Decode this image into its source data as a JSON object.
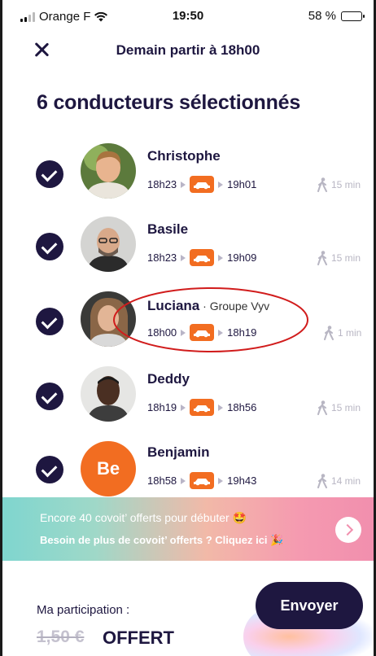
{
  "status_bar": {
    "carrier": "Orange F",
    "time": "19:50",
    "battery": "58 %",
    "battery_level": 0.58
  },
  "header": {
    "title": "Demain partir à 18h00"
  },
  "page_title": "6 conducteurs sélectionnés",
  "drivers": [
    {
      "name": "Christophe",
      "company": "",
      "depart": "18h23",
      "arrive": "19h01",
      "walk": "15 min",
      "avatar_bg": "#6f8a4a"
    },
    {
      "name": "Basile",
      "company": "",
      "depart": "18h23",
      "arrive": "19h09",
      "walk": "15 min",
      "avatar_bg": "#cfcfcf"
    },
    {
      "name": "Luciana",
      "company": " · Groupe Vyv",
      "depart": "18h00",
      "arrive": "18h19",
      "walk": "1 min",
      "avatar_bg": "#7a5a44"
    },
    {
      "name": "Deddy",
      "company": "",
      "depart": "18h19",
      "arrive": "18h56",
      "walk": "15 min",
      "avatar_bg": "#dcdcdc"
    },
    {
      "name": "Benjamin",
      "initials": "Be",
      "company": "",
      "depart": "18h58",
      "arrive": "19h43",
      "walk": "14 min",
      "avatar_bg": "#f26d21"
    }
  ],
  "promo": {
    "line1": "Encore 40 covoit’ offerts pour débuter 🤩",
    "line2": "Besoin de plus de covoit’ offerts ? Cliquez ici 🎉"
  },
  "footer": {
    "participation_label": "Ma participation :",
    "old_price": "1,50 €",
    "new_price": "OFFERT",
    "send_label": "Envoyer"
  },
  "colors": {
    "brand_dark": "#1e1740",
    "car_orange": "#f26d21",
    "annotation_red": "#d11c1c"
  }
}
